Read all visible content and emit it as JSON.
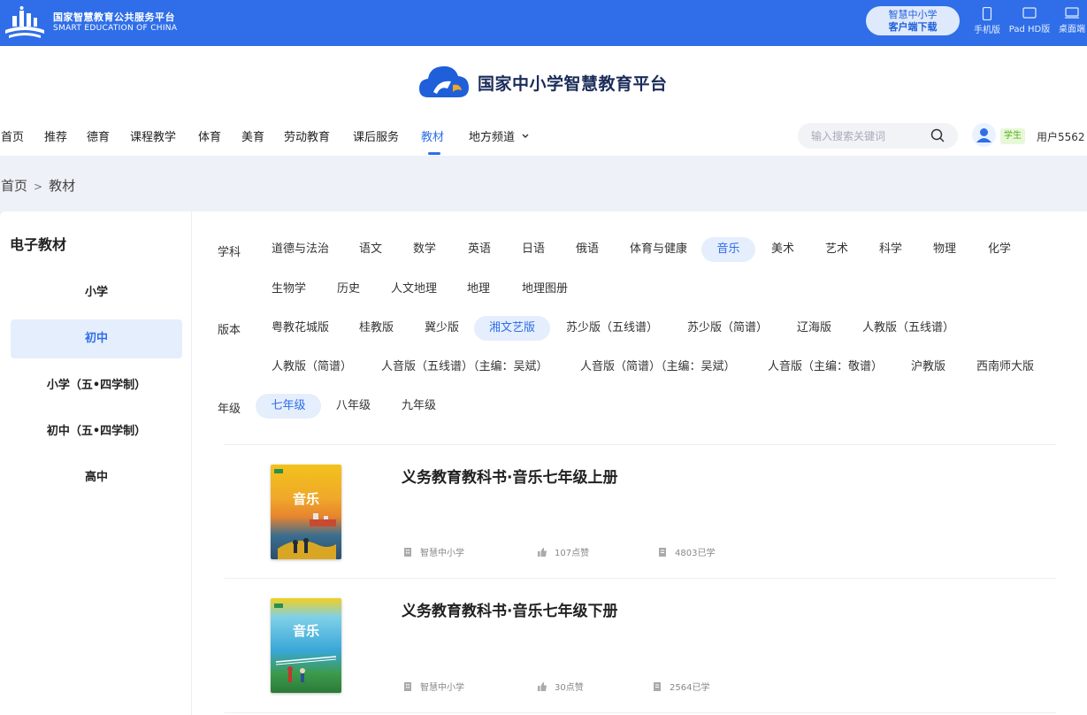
{
  "topbar": {
    "brand_cn": "国家智慧教育公共服务平台",
    "brand_en": "SMART EDUCATION OF CHINA",
    "client_line1": "智慧中小学",
    "client_line2": "客户端下载",
    "devices": [
      "手机版",
      "Pad HD版",
      "桌面端"
    ]
  },
  "header": {
    "site_title": "国家中小学智慧教育平台",
    "nav": [
      "首页",
      "推荐",
      "德育",
      "课程教学",
      "体育",
      "美育",
      "劳动教育",
      "课后服务",
      "教材",
      "地方频道"
    ],
    "active_nav": "教材",
    "search_placeholder": "输入搜索关键词",
    "role": "学生",
    "username": "用户5562"
  },
  "breadcrumb": {
    "home": "首页",
    "sep": ">",
    "current": "教材"
  },
  "sidebar": {
    "title": "电子教材",
    "items": [
      "小学",
      "初中",
      "小学（五•四学制）",
      "初中（五•四学制）",
      "高中"
    ],
    "active": "初中"
  },
  "filters": {
    "subject_label": "学科",
    "subjects": [
      "道德与法治",
      "语文",
      "数学",
      "英语",
      "日语",
      "俄语",
      "体育与健康",
      "音乐",
      "美术",
      "艺术",
      "科学",
      "物理",
      "化学",
      "生物学",
      "历史",
      "人文地理",
      "地理",
      "地理图册"
    ],
    "subject_selected": "音乐",
    "edition_label": "版本",
    "editions": [
      "粤教花城版",
      "桂教版",
      "冀少版",
      "湘文艺版",
      "苏少版（五线谱）",
      "苏少版（简谱）",
      "辽海版",
      "人教版（五线谱）",
      "人教版（简谱）",
      "人音版（五线谱）（主编：吴斌）",
      "人音版（简谱）（主编：吴斌）",
      "人音版（主编：敬谱）",
      "沪教版",
      "西南师大版"
    ],
    "edition_selected": "湘文艺版",
    "grade_label": "年级",
    "grades": [
      "七年级",
      "八年级",
      "九年级"
    ],
    "grade_selected": "七年级"
  },
  "books": [
    {
      "title": "义务教育教科书·音乐七年级上册",
      "cover_text": "音乐",
      "publisher": "智慧中小学",
      "likes": "107点赞",
      "learners": "4803已学"
    },
    {
      "title": "义务教育教科书·音乐七年级下册",
      "cover_text": "音乐",
      "publisher": "智慧中小学",
      "likes": "30点赞",
      "learners": "2564已学"
    }
  ],
  "colors": {
    "primary": "#2f6ee8",
    "selected_bg": "#e5eefc",
    "role_green": "#56b01a"
  }
}
